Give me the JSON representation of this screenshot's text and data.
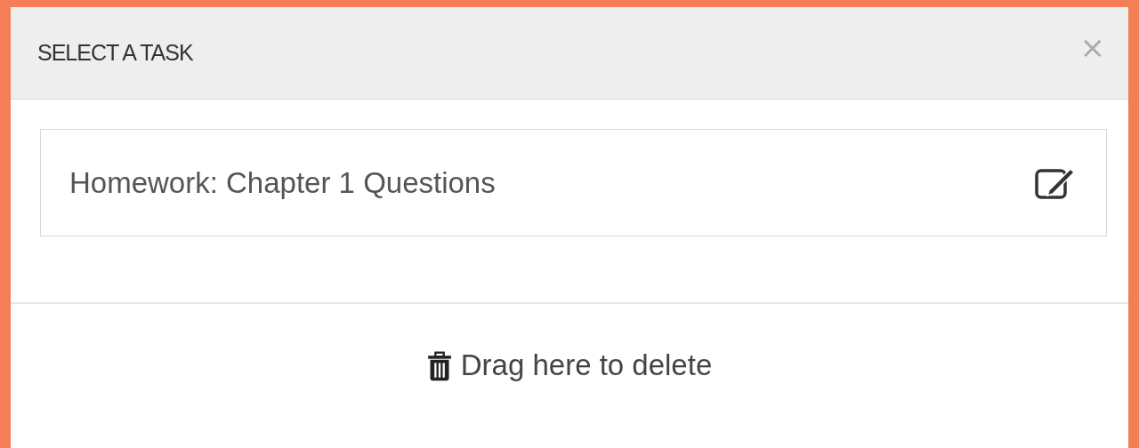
{
  "dialog": {
    "title": "SELECT A TASK",
    "close": "×"
  },
  "tasks": [
    {
      "label": "Homework: Chapter 1 Questions"
    }
  ],
  "drop_zone": {
    "label": "Drag here to delete"
  }
}
